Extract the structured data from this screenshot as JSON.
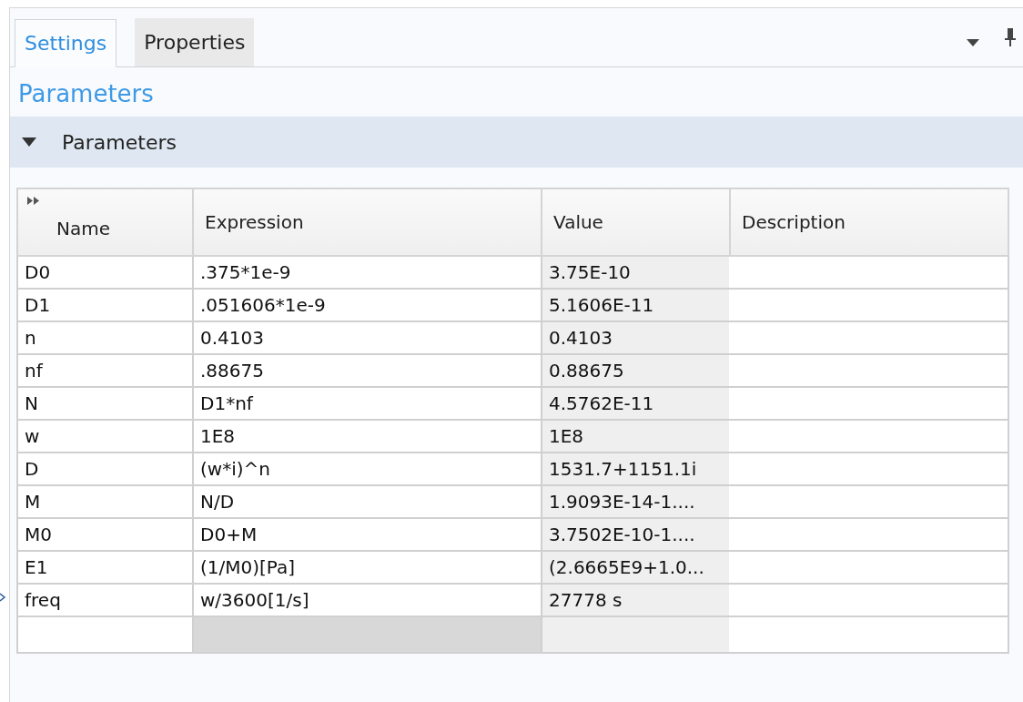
{
  "tabs": [
    {
      "label": "Settings",
      "selected": true
    },
    {
      "label": "Properties",
      "selected": false
    }
  ],
  "heading": "Parameters",
  "section": {
    "title": "Parameters",
    "expanded": true
  },
  "table": {
    "columns": [
      "Name",
      "Expression",
      "Value",
      "Description"
    ],
    "rows": [
      {
        "name": "D0",
        "expression": ".375*1e-9",
        "value": "3.75E-10"
      },
      {
        "name": "D1",
        "expression": ".051606*1e-9",
        "value": "5.1606E-11"
      },
      {
        "name": "n",
        "expression": "0.4103",
        "value": "0.4103"
      },
      {
        "name": "nf",
        "expression": ".88675",
        "value": "0.88675"
      },
      {
        "name": "N",
        "expression": "D1*nf",
        "value": "4.5762E-11"
      },
      {
        "name": "w",
        "expression": "1E8",
        "value": "1E8"
      },
      {
        "name": "D",
        "expression": "(w*i)^n",
        "value": "1531.7+1151.1i"
      },
      {
        "name": "M",
        "expression": "N/D",
        "value": "1.9093E-14-1...."
      },
      {
        "name": "M0",
        "expression": "D0+M",
        "value": "3.7502E-10-1...."
      },
      {
        "name": "E1",
        "expression": "(1/M0)[Pa]",
        "value": "(2.6665E9+1.0..."
      },
      {
        "name": "freq",
        "expression": "w/3600[1/s]",
        "value": "27778 s"
      }
    ]
  }
}
